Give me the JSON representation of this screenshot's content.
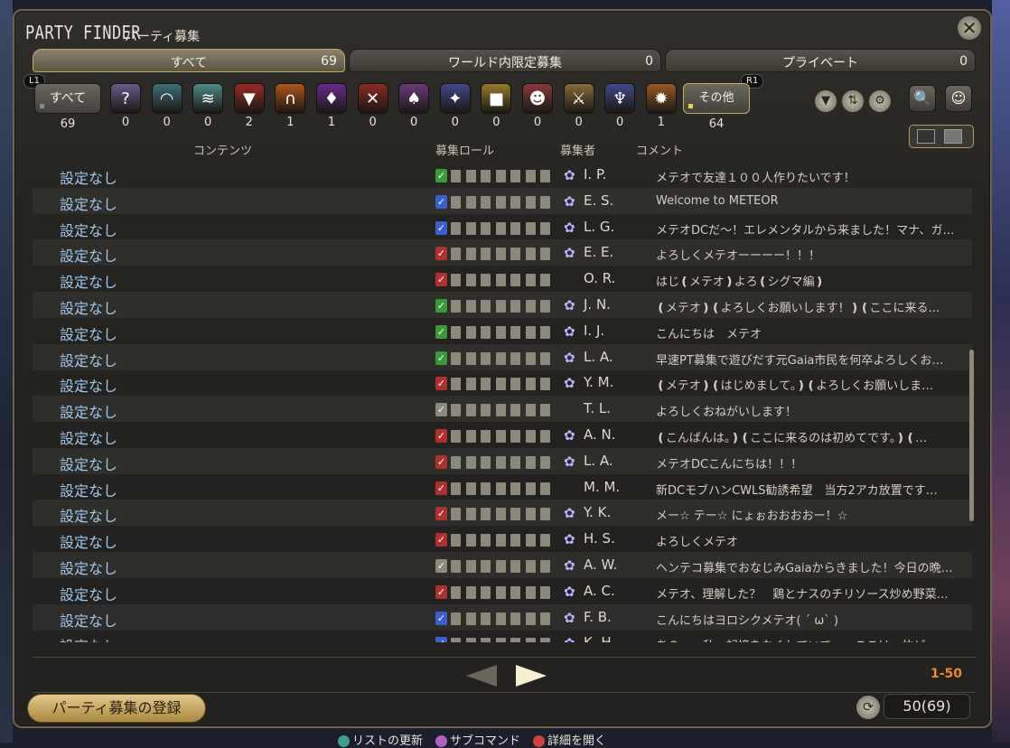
{
  "window": {
    "title": "PARTY FINDER",
    "subtitle": "パーティ募集",
    "close_glyph": "✕"
  },
  "tabs": [
    {
      "label": "すべて",
      "count": "69"
    },
    {
      "label": "ワールド内限定募集",
      "count": "0"
    },
    {
      "label": "プライベート",
      "count": "0"
    }
  ],
  "shoulder": {
    "left": "L1",
    "right": "R1"
  },
  "categories": {
    "all": {
      "label": "すべて",
      "count": "69"
    },
    "items": [
      {
        "icon": "question-icon",
        "glyph": "?",
        "count": "0",
        "color": "#6a5a8c"
      },
      {
        "icon": "dungeon-icon",
        "glyph": "◠",
        "count": "0",
        "color": "#3f6f7a"
      },
      {
        "icon": "scroll-icon",
        "glyph": "≋",
        "count": "0",
        "color": "#4f8a8a"
      },
      {
        "icon": "trial-icon",
        "glyph": "▼",
        "count": "2",
        "color": "#9a2a22"
      },
      {
        "icon": "raid-icon",
        "glyph": "∩",
        "count": "1",
        "color": "#b0561a"
      },
      {
        "icon": "alliance-icon",
        "glyph": "♦",
        "count": "1",
        "color": "#6a2a8c"
      },
      {
        "icon": "pvp-icon",
        "glyph": "✕",
        "count": "0",
        "color": "#8c2a24"
      },
      {
        "icon": "gold-saucer-icon",
        "glyph": "♠",
        "count": "0",
        "color": "#6a3a7a"
      },
      {
        "icon": "deep-dungeon-icon",
        "glyph": "✦",
        "count": "0",
        "color": "#3f4a8a"
      },
      {
        "icon": "treasure-icon",
        "glyph": "■",
        "count": "0",
        "color": "#9a7a2a"
      },
      {
        "icon": "fate-icon",
        "glyph": "☻",
        "count": "0",
        "color": "#8a3a3a"
      },
      {
        "icon": "hunt-icon",
        "glyph": "⚔",
        "count": "0",
        "color": "#8a6a3a"
      },
      {
        "icon": "field-icon",
        "glyph": "♆",
        "count": "0",
        "color": "#3f4a8a"
      },
      {
        "icon": "varied-icon",
        "glyph": "✹",
        "count": "1",
        "color": "#9a5a22"
      }
    ],
    "other": {
      "label": "その他",
      "count": "64"
    }
  },
  "tools": {
    "filter": "▼",
    "sort": "⇅",
    "settings": "⚙",
    "search": "🔍",
    "profile": "☺"
  },
  "columns": {
    "content": "コンテンツ",
    "role": "募集ロール",
    "recruiter": "募集者",
    "comment": "コメント"
  },
  "colors": {
    "tank": "#3a5fd0",
    "healer": "#3a9a3a",
    "dps": "#b03030",
    "none": "#8c887c",
    "page_range": "#e88c2a"
  },
  "rows": [
    {
      "content": "設定なし",
      "role": "healer",
      "job": true,
      "name": "I. P.",
      "comment": "メテオで友達１００人作りたいです！"
    },
    {
      "content": "設定なし",
      "role": "tank",
      "job": true,
      "name": "E. S.",
      "comment": "Welcome to METEOR"
    },
    {
      "content": "設定なし",
      "role": "tank",
      "job": true,
      "name": "L. G.",
      "comment": "メテオDCだ～！エレメンタルから来ました！マナ、ガ…"
    },
    {
      "content": "設定なし",
      "role": "dps",
      "job": true,
      "name": "E. E.",
      "comment": "よろしくメテオーーーー！！！"
    },
    {
      "content": "設定なし",
      "role": "dps",
      "job": false,
      "name": "O. R.",
      "comment": "はじ❪メテオ❫よろ❪シグマ編❫"
    },
    {
      "content": "設定なし",
      "role": "healer",
      "job": true,
      "name": "J. N.",
      "comment": "❪メテオ❫❪よろしくお願いします！❫❪ここに来る…"
    },
    {
      "content": "設定なし",
      "role": "healer",
      "job": true,
      "name": "I. J.",
      "comment": "こんにちは　メテオ"
    },
    {
      "content": "設定なし",
      "role": "healer",
      "job": true,
      "name": "L. A.",
      "comment": "早速PT募集で遊びだす元Gaia市民を何卒よろしくお…"
    },
    {
      "content": "設定なし",
      "role": "dps",
      "job": true,
      "name": "Y. M.",
      "comment": "❪メテオ❫❪はじめまして。❫❪よろしくお願いしま…"
    },
    {
      "content": "設定なし",
      "role": "none",
      "job": false,
      "name": "T. L.",
      "comment": "よろしくおねがいします！"
    },
    {
      "content": "設定なし",
      "role": "dps",
      "job": true,
      "name": "A. N.",
      "comment": "❪こんばんは。❫❪ここに来るのは初めてです。❫❪…"
    },
    {
      "content": "設定なし",
      "role": "dps",
      "job": true,
      "name": "L. A.",
      "comment": "メテオDCこんにちは！！！"
    },
    {
      "content": "設定なし",
      "role": "dps",
      "job": false,
      "name": "M. M.",
      "comment": "新DCモブハンCWLS勧誘希望　当方2アカ放置です…"
    },
    {
      "content": "設定なし",
      "role": "dps",
      "job": true,
      "name": "Y. K.",
      "comment": "メー☆ テー☆ にょぉおおおおー！☆"
    },
    {
      "content": "設定なし",
      "role": "dps",
      "job": true,
      "name": "H. S.",
      "comment": "よろしくメテオ"
    },
    {
      "content": "設定なし",
      "role": "none",
      "job": true,
      "name": "A. W.",
      "comment": "ヘンテコ募集でおなじみGaiaからきました！今日の晩…"
    },
    {
      "content": "設定なし",
      "role": "dps",
      "job": true,
      "name": "A. C.",
      "comment": "メテオ、理解した？　鶏とナスのチリソース炒め野菜…"
    },
    {
      "content": "設定なし",
      "role": "tank",
      "job": true,
      "name": "F. B.",
      "comment": "こんにちはヨロシクメテオ( ´ ω` )"
    },
    {
      "content": "設定なし",
      "role": "tank",
      "job": true,
      "name": "K. H.",
      "comment": "あの……私、記憶をなくしていて……ここは一体ど…"
    }
  ],
  "pager": {
    "range": "1-50"
  },
  "footer": {
    "register": "パーティ募集の登録",
    "refresh_glyph": "⟳",
    "count": "50(69)"
  },
  "hints": [
    {
      "color": "#3aa08a",
      "label": "リストの更新"
    },
    {
      "color": "#b060c0",
      "label": "サブコマンド"
    },
    {
      "color": "#d04040",
      "label": "詳細を開く"
    }
  ]
}
